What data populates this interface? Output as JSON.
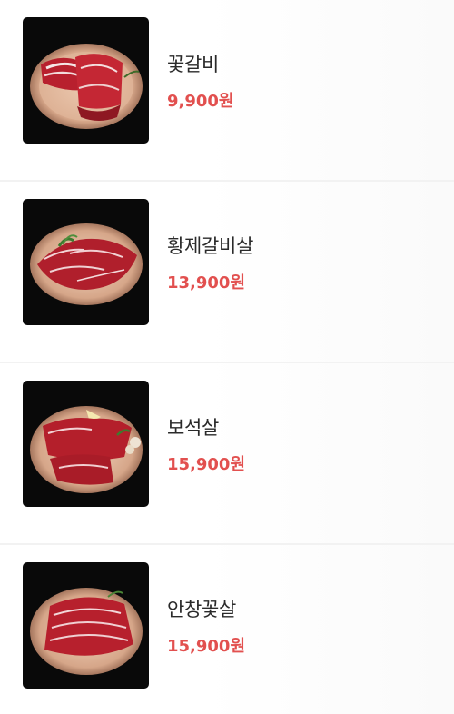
{
  "menu": {
    "items": [
      {
        "name": "꽃갈비",
        "price": "9,900원",
        "image": "meat-photo-icon"
      },
      {
        "name": "황제갈비살",
        "price": "13,900원",
        "image": "meat-photo-icon"
      },
      {
        "name": "보석살",
        "price": "15,900원",
        "image": "meat-photo-icon"
      },
      {
        "name": "안창꽃살",
        "price": "15,900원",
        "image": "meat-photo-icon"
      }
    ]
  },
  "colors": {
    "price": "#e2504f",
    "name": "#2a2a2a",
    "divider": "#f2f2f2",
    "photo_background": "#090909"
  }
}
